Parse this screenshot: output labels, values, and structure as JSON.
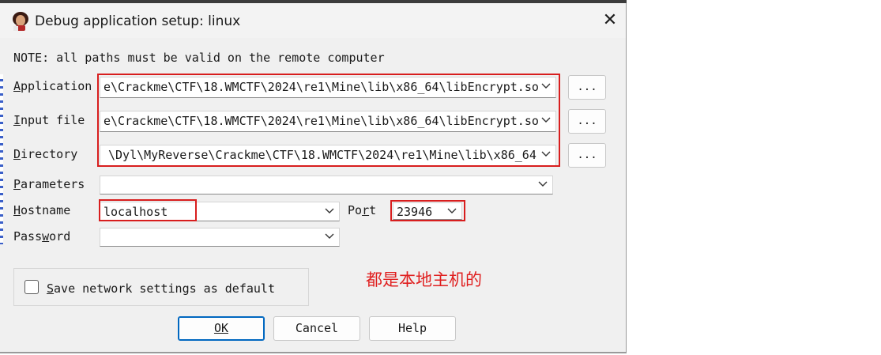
{
  "window": {
    "title": "Debug application setup: linux",
    "close_glyph": "✕"
  },
  "note": "NOTE: all paths must be valid on the remote computer",
  "fields": {
    "application": {
      "label": "Application",
      "value": "e\\Crackme\\CTF\\18.WMCTF\\2024\\re1\\Mine\\lib\\x86_64\\libEncrypt.so",
      "browse": "..."
    },
    "input_file": {
      "label": "Input file",
      "value": "e\\Crackme\\CTF\\18.WMCTF\\2024\\re1\\Mine\\lib\\x86_64\\libEncrypt.so",
      "browse": "..."
    },
    "directory": {
      "label": "Directory",
      "value": "\\Dyl\\MyReverse\\Crackme\\CTF\\18.WMCTF\\2024\\re1\\Mine\\lib\\x86_64",
      "browse": "..."
    },
    "parameters": {
      "label": "Parameters",
      "value": ""
    },
    "hostname": {
      "label": "Hostname",
      "value": "localhost"
    },
    "port": {
      "label": "Port",
      "value": "23946"
    },
    "password": {
      "label": "Password",
      "value": ""
    }
  },
  "save_settings": {
    "label": "Save network settings as default",
    "checked": false
  },
  "annotation": {
    "text": "都是本地主机的",
    "color": "#e02020"
  },
  "buttons": {
    "ok": "OK",
    "cancel": "Cancel",
    "help": "Help"
  },
  "colors": {
    "highlight": "#d81e1e",
    "default_button_border": "#0067c0"
  }
}
